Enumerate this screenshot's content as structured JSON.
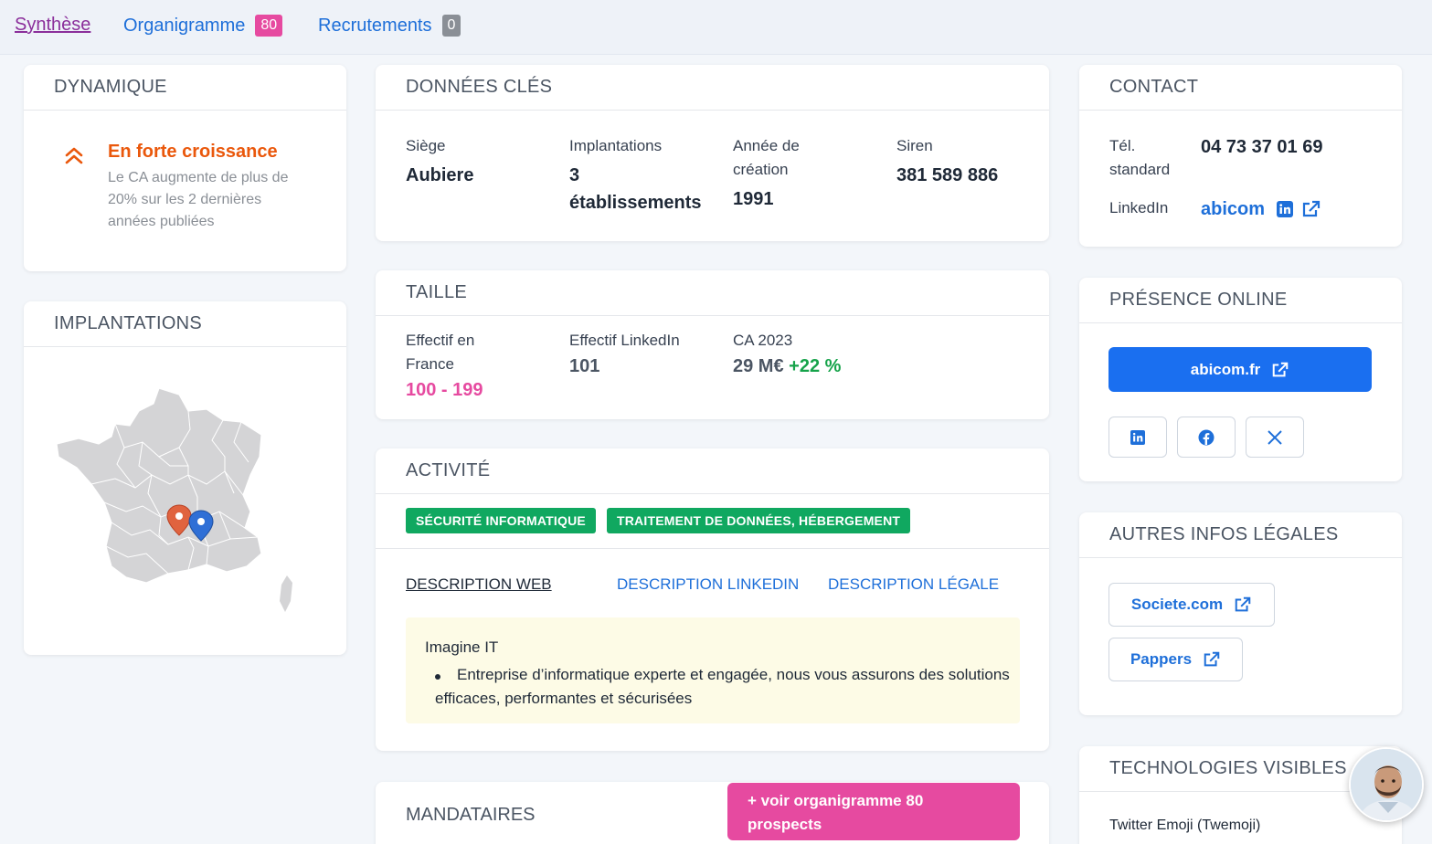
{
  "nav": {
    "tabs": [
      {
        "label": "Synthèse"
      },
      {
        "label": "Organigramme",
        "badge": "80",
        "badge_color": "#e64aa0"
      },
      {
        "label": "Recrutements",
        "badge": "0",
        "badge_color": "#8a8f96"
      }
    ]
  },
  "dynamique": {
    "title": "DYNAMIQUE",
    "status": "En forte croissance",
    "status_color": "#ea580c",
    "description": "Le CA augmente de plus de 20% sur les 2 dernières années publiées"
  },
  "implantations": {
    "title": "IMPLANTATIONS"
  },
  "donnees_cles": {
    "title": "DONNÉES CLÉS",
    "siege_label": "Siège",
    "siege_value": "Aubiere",
    "implantations_label": "Implantations",
    "implantations_value": "3 établissements",
    "annee_label": "Année de création",
    "annee_value": "1991",
    "siren_label": "Siren",
    "siren_value": "381 589 886"
  },
  "taille": {
    "title": "TAILLE",
    "effectif_fr_label": "Effectif en France",
    "effectif_fr_value": "100 - 199",
    "effectif_li_label": "Effectif LinkedIn",
    "effectif_li_value": "101",
    "ca_label": "CA 2023",
    "ca_value": "29 M€",
    "ca_growth": "+22 %"
  },
  "activite": {
    "title": "ACTIVITÉ",
    "tags": [
      "SÉCURITÉ INFORMATIQUE",
      "TRAITEMENT DE DONNÉES, HÉBERGEMENT"
    ],
    "tabs": [
      "DESCRIPTION WEB",
      "DESCRIPTION LINKEDIN",
      "DESCRIPTION LÉGALE"
    ],
    "desc_title": "Imagine IT",
    "desc_bullet": "Entreprise d’informatique experte et engagée, nous vous assurons des solutions efficaces, performantes et sécurisées"
  },
  "mandataires": {
    "title": "MANDATAIRES",
    "cta": "+ voir organigramme 80 prospects"
  },
  "contact": {
    "title": "CONTACT",
    "tel_label": "Tél. standard",
    "tel_value": "04 73 37 01 69",
    "linkedin_label": "LinkedIn",
    "linkedin_value": "abicom"
  },
  "presence": {
    "title": "PRÉSENCE ONLINE",
    "website": "abicom.fr"
  },
  "legales": {
    "title": "AUTRES INFOS LÉGALES",
    "links": [
      "Societe.com",
      "Pappers"
    ]
  },
  "technologies": {
    "title": "TECHNOLOGIES VISIBLES",
    "items": [
      "Twitter Emoji (Twemoji)"
    ]
  }
}
